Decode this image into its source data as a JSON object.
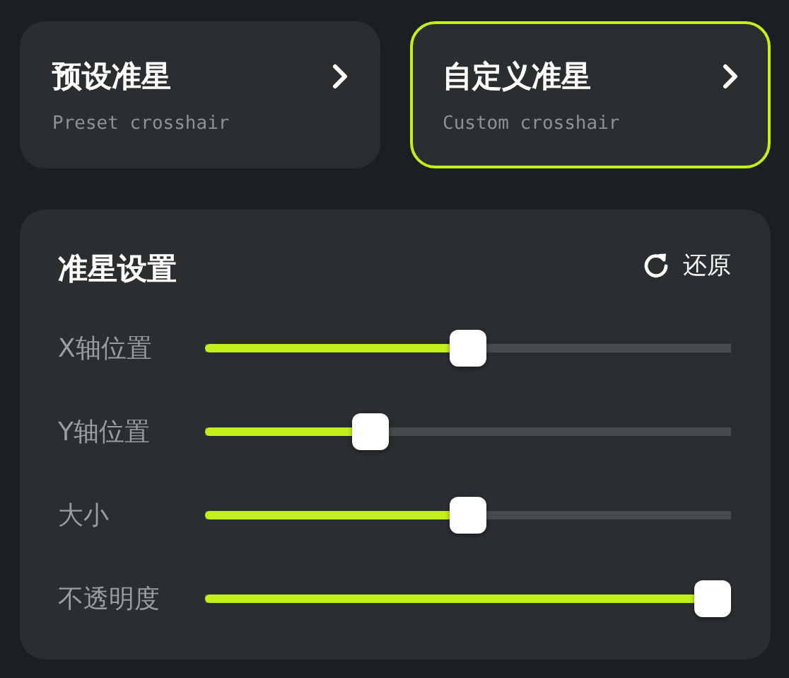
{
  "modes": [
    {
      "title": "预设准星",
      "subtitle": "Preset crosshair",
      "selected": false
    },
    {
      "title": "自定义准星",
      "subtitle": "Custom crosshair",
      "selected": true
    }
  ],
  "settings": {
    "title": "准星设置",
    "reset_label": "还原",
    "sliders": [
      {
        "label": "X轴位置",
        "level": 0.5
      },
      {
        "label": "Y轴位置",
        "level": 0.3
      },
      {
        "label": "大小",
        "level": 0.5
      },
      {
        "label": "不透明度",
        "level": 1
      }
    ]
  }
}
